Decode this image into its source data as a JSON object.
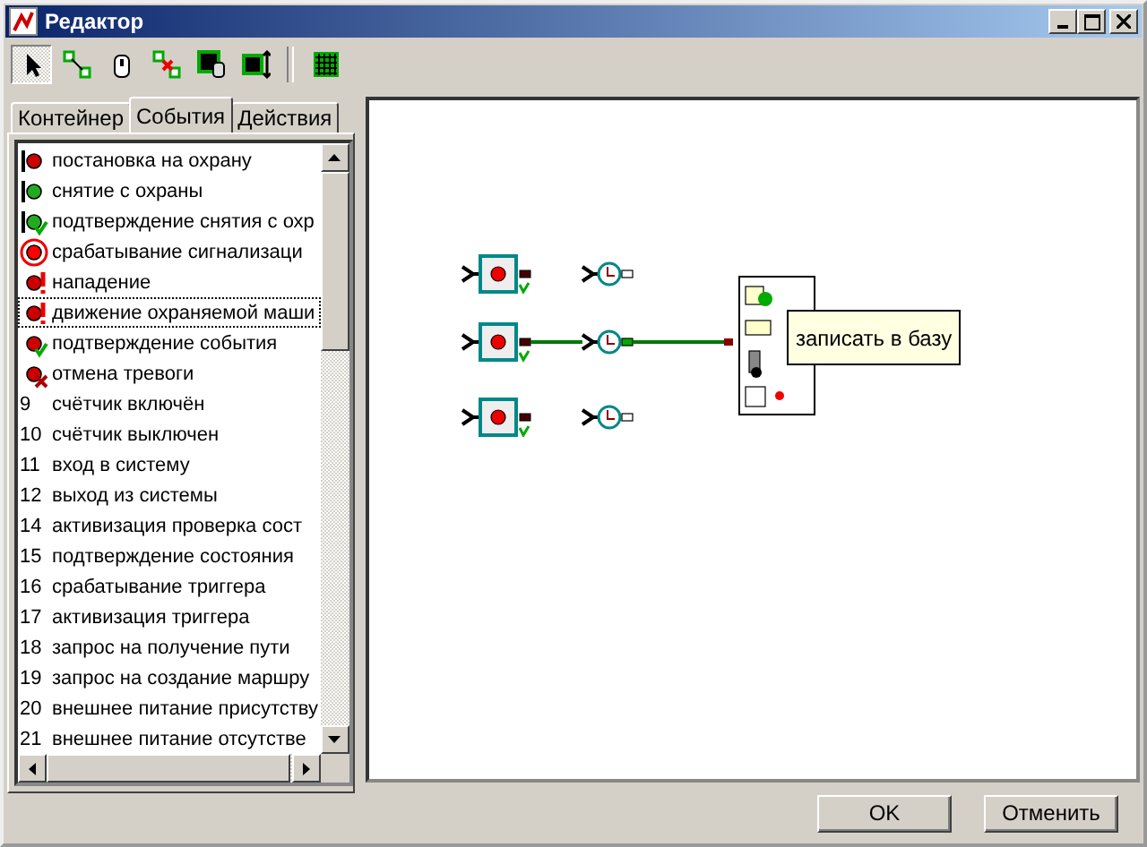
{
  "window": {
    "title": "Редактор"
  },
  "toolbar": [
    {
      "kind": "pointer",
      "selected": true
    },
    {
      "kind": "link",
      "selected": false
    },
    {
      "kind": "mouse",
      "selected": false
    },
    {
      "kind": "unlink",
      "selected": false
    },
    {
      "kind": "container",
      "selected": false
    },
    {
      "kind": "resize",
      "selected": false
    },
    {
      "kind": "grid",
      "selected": false
    }
  ],
  "tabs": [
    {
      "label": "Контейнер",
      "selected": false
    },
    {
      "label": "События",
      "selected": true
    },
    {
      "label": "Действия",
      "selected": false
    }
  ],
  "events": [
    {
      "kind": "icon",
      "label": "постановка на охрану",
      "focused": false
    },
    {
      "kind": "icon",
      "label": "снятие с охраны",
      "focused": false
    },
    {
      "kind": "icon",
      "label": "подтверждение снятия с охр",
      "focused": false
    },
    {
      "kind": "icon",
      "label": "срабатывание сигнализаци",
      "focused": false
    },
    {
      "kind": "icon",
      "label": "нападение",
      "focused": false
    },
    {
      "kind": "icon",
      "label": "движение охраняемой маши",
      "focused": true
    },
    {
      "kind": "icon",
      "label": "подтверждение события",
      "focused": false
    },
    {
      "kind": "icon",
      "label": "отмена тревоги",
      "focused": false
    },
    {
      "kind": "number",
      "number": "9",
      "label": "счётчик включён",
      "focused": false
    },
    {
      "kind": "number",
      "number": "10",
      "label": "счётчик выключен",
      "focused": false
    },
    {
      "kind": "number",
      "number": "11",
      "label": "вход в систему",
      "focused": false
    },
    {
      "kind": "number",
      "number": "12",
      "label": "выход из системы",
      "focused": false
    },
    {
      "kind": "number",
      "number": "14",
      "label": "активизация проверка сост",
      "focused": false
    },
    {
      "kind": "number",
      "number": "15",
      "label": "подтверждение состояния",
      "focused": false
    },
    {
      "kind": "number",
      "number": "16",
      "label": "срабатывание триггера",
      "focused": false
    },
    {
      "kind": "number",
      "number": "17",
      "label": "активизация триггера",
      "focused": false
    },
    {
      "kind": "number",
      "number": "18",
      "label": "запрос на получение пути",
      "focused": false
    },
    {
      "kind": "number",
      "number": "19",
      "label": "запрос на создание маршру",
      "focused": false
    },
    {
      "kind": "number",
      "number": "20",
      "label": "внешнее питание присутству",
      "focused": false
    },
    {
      "kind": "number",
      "number": "21",
      "label": "внешнее питание отсутстве",
      "focused": false
    }
  ],
  "canvas": {
    "tooltip": "записать в базу"
  },
  "buttons": [
    "OK",
    "Отменить"
  ]
}
